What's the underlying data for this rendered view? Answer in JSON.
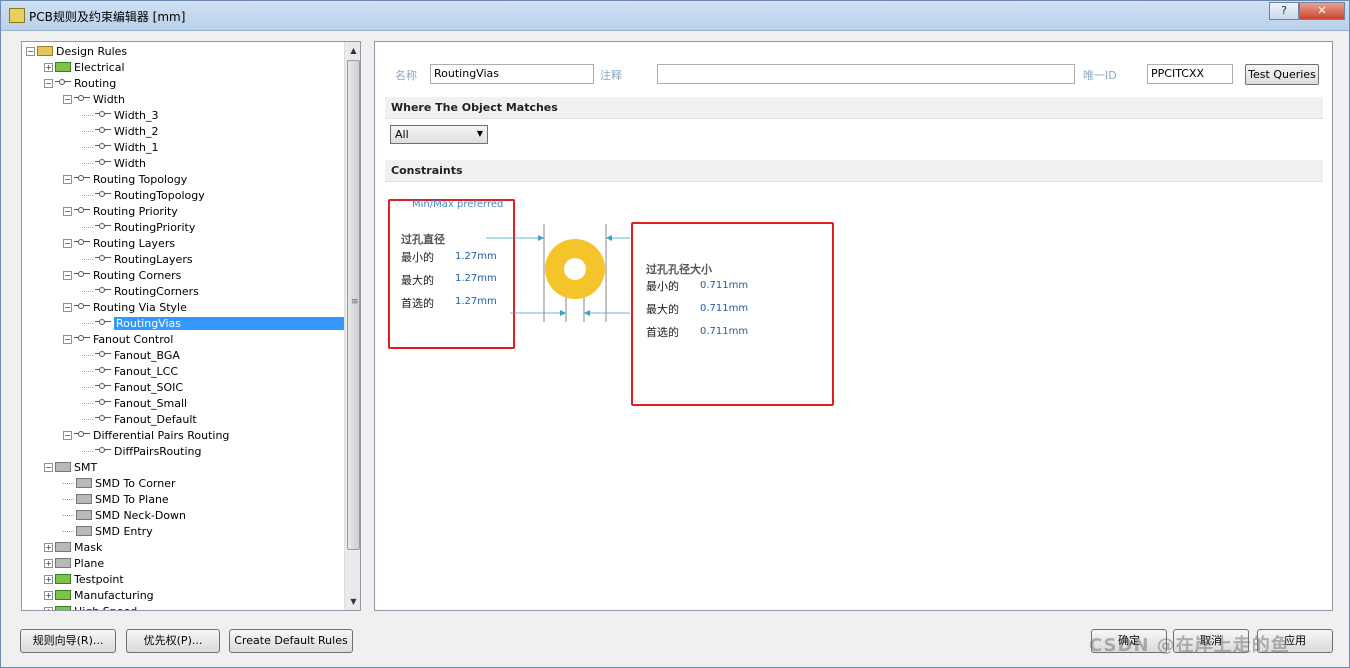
{
  "window": {
    "title": "PCB规则及约束编辑器 [mm]"
  },
  "window_buttons": {
    "help": "?",
    "minimize": "—",
    "close": "✕"
  },
  "tree": {
    "items": [
      {
        "label": "Design Rules",
        "level": 0,
        "expander": "−",
        "icon": "folder"
      },
      {
        "label": "Electrical",
        "level": 1,
        "expander": "+",
        "icon": "electrical"
      },
      {
        "label": "Routing",
        "level": 1,
        "expander": "−",
        "icon": "rule"
      },
      {
        "label": "Width",
        "level": 2,
        "expander": "−",
        "icon": "rule"
      },
      {
        "label": "Width_3",
        "level": 3,
        "icon": "rule"
      },
      {
        "label": "Width_2",
        "level": 3,
        "icon": "rule"
      },
      {
        "label": "Width_1",
        "level": 3,
        "icon": "rule"
      },
      {
        "label": "Width",
        "level": 3,
        "icon": "rule"
      },
      {
        "label": "Routing Topology",
        "level": 2,
        "expander": "−",
        "icon": "rule"
      },
      {
        "label": "RoutingTopology",
        "level": 3,
        "icon": "rule"
      },
      {
        "label": "Routing Priority",
        "level": 2,
        "expander": "−",
        "icon": "rule"
      },
      {
        "label": "RoutingPriority",
        "level": 3,
        "icon": "rule"
      },
      {
        "label": "Routing Layers",
        "level": 2,
        "expander": "−",
        "icon": "rule"
      },
      {
        "label": "RoutingLayers",
        "level": 3,
        "icon": "rule"
      },
      {
        "label": "Routing Corners",
        "level": 2,
        "expander": "−",
        "icon": "rule"
      },
      {
        "label": "RoutingCorners",
        "level": 3,
        "icon": "rule"
      },
      {
        "label": "Routing Via Style",
        "level": 2,
        "expander": "−",
        "icon": "rule"
      },
      {
        "label": "RoutingVias",
        "level": 3,
        "icon": "rule",
        "selected": true
      },
      {
        "label": "Fanout Control",
        "level": 2,
        "expander": "−",
        "icon": "rule"
      },
      {
        "label": "Fanout_BGA",
        "level": 3,
        "icon": "rule"
      },
      {
        "label": "Fanout_LCC",
        "level": 3,
        "icon": "rule"
      },
      {
        "label": "Fanout_SOIC",
        "level": 3,
        "icon": "rule"
      },
      {
        "label": "Fanout_Small",
        "level": 3,
        "icon": "rule"
      },
      {
        "label": "Fanout_Default",
        "level": 3,
        "icon": "rule"
      },
      {
        "label": "Differential Pairs Routing",
        "level": 2,
        "expander": "−",
        "icon": "rule"
      },
      {
        "label": "DiffPairsRouting",
        "level": 3,
        "icon": "rule"
      },
      {
        "label": "SMT",
        "level": 1,
        "expander": "−",
        "icon": "smt"
      },
      {
        "label": "SMD To Corner",
        "level": 2,
        "icon": "smt"
      },
      {
        "label": "SMD To Plane",
        "level": 2,
        "icon": "smt"
      },
      {
        "label": "SMD Neck-Down",
        "level": 2,
        "icon": "smt"
      },
      {
        "label": "SMD Entry",
        "level": 2,
        "icon": "smt"
      },
      {
        "label": "Mask",
        "level": 1,
        "expander": "+",
        "icon": "mask"
      },
      {
        "label": "Plane",
        "level": 1,
        "expander": "+",
        "icon": "plane"
      },
      {
        "label": "Testpoint",
        "level": 1,
        "expander": "+",
        "icon": "testpoint"
      },
      {
        "label": "Manufacturing",
        "level": 1,
        "expander": "+",
        "icon": "manufacturing"
      },
      {
        "label": "High Speed",
        "level": 1,
        "expander": "+",
        "icon": "highspeed"
      }
    ]
  },
  "rule": {
    "name_label": "名称",
    "name_value": "RoutingVias",
    "comment_label": "注释",
    "comment_value": "",
    "id_label": "唯一ID",
    "id_value": "PPCITCXX",
    "test_queries": "Test Queries"
  },
  "where_section": {
    "title": "Where The Object Matches",
    "select_value": "All"
  },
  "constraints_section": {
    "title": "Constraints"
  },
  "via_constraints": {
    "preference_note": "Min/Max preferred",
    "diameter": {
      "heading": "过孔直径",
      "min_label": "最小的",
      "min_value": "1.27mm",
      "max_label": "最大的",
      "max_value": "1.27mm",
      "pref_label": "首选的",
      "pref_value": "1.27mm"
    },
    "hole": {
      "heading": "过孔孔径大小",
      "min_label": "最小的",
      "min_value": "0.711mm",
      "max_label": "最大的",
      "max_value": "0.711mm",
      "pref_label": "首选的",
      "pref_value": "0.711mm"
    },
    "via_color": "#f5c32a"
  },
  "bottom_buttons": {
    "wizard": "规则向导(R)...",
    "priority": "优先权(P)...",
    "create_defaults": "Create Default Rules",
    "ok": "确定",
    "cancel": "取消",
    "apply": "应用"
  },
  "watermark": "CSDN @在岸上走的鱼"
}
